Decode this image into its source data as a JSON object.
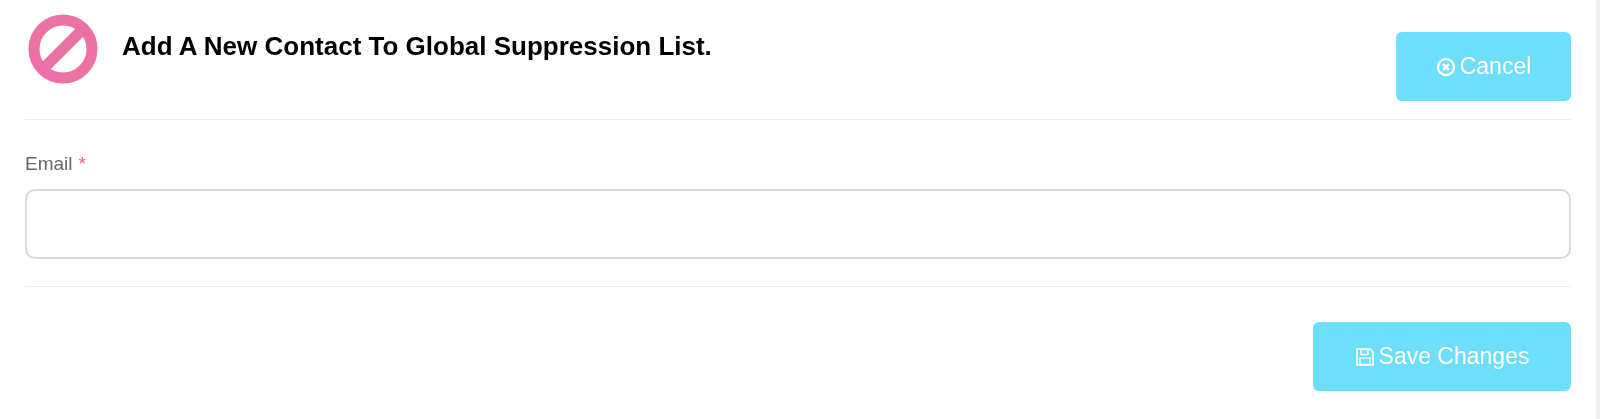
{
  "header": {
    "title": "Add A New Contact To Global Suppression List.",
    "cancel_button": "Cancel"
  },
  "form": {
    "fields": [
      {
        "label": "Email",
        "required_mark": "*"
      }
    ]
  },
  "footer": {
    "save_button": "Save Changes"
  }
}
